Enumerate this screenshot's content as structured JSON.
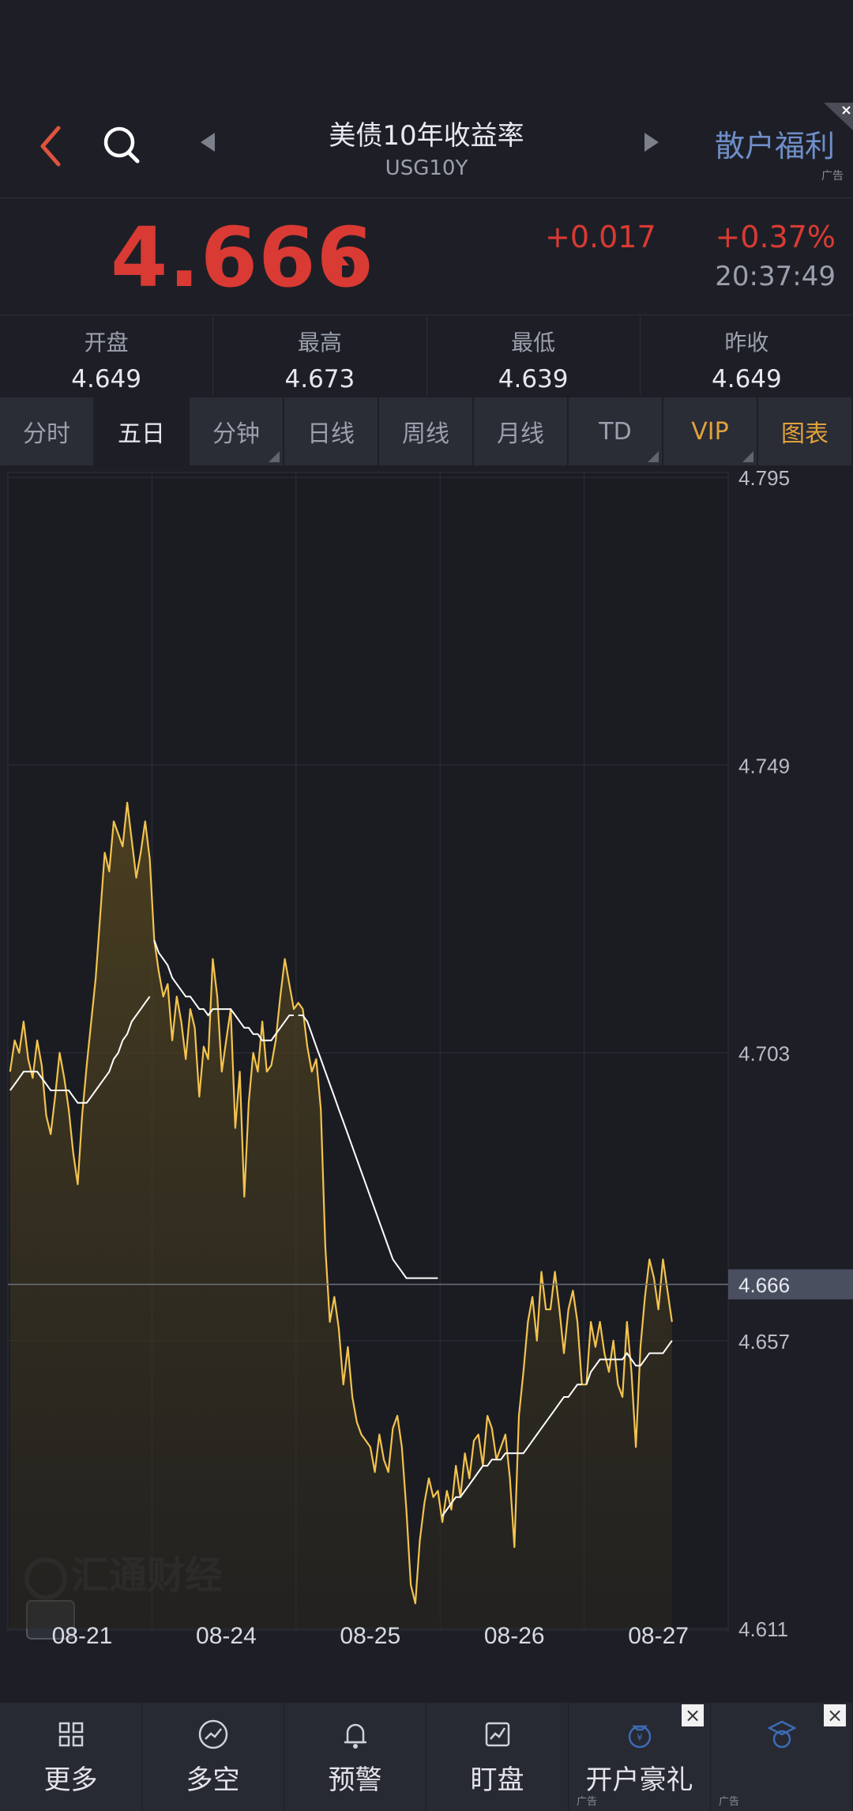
{
  "header": {
    "title": "美债10年收益率",
    "symbol": "USG10Y",
    "promo": "散户福利",
    "ad_label": "广告"
  },
  "quote": {
    "price": "4.666",
    "change": "+0.017",
    "change_pct": "+0.37%",
    "time": "20:37:49",
    "color": "#d93a33"
  },
  "stats": [
    {
      "label": "开盘",
      "value": "4.649"
    },
    {
      "label": "最高",
      "value": "4.673"
    },
    {
      "label": "最低",
      "value": "4.639"
    },
    {
      "label": "昨收",
      "value": "4.649"
    }
  ],
  "tabs": [
    {
      "label": "分时",
      "active": false,
      "dropdown": false,
      "gold": false
    },
    {
      "label": "五日",
      "active": true,
      "dropdown": false,
      "gold": false
    },
    {
      "label": "分钟",
      "active": false,
      "dropdown": true,
      "gold": false
    },
    {
      "label": "日线",
      "active": false,
      "dropdown": false,
      "gold": false
    },
    {
      "label": "周线",
      "active": false,
      "dropdown": false,
      "gold": false
    },
    {
      "label": "月线",
      "active": false,
      "dropdown": false,
      "gold": false
    },
    {
      "label": "TD",
      "active": false,
      "dropdown": true,
      "gold": false
    },
    {
      "label": "VIP",
      "active": false,
      "dropdown": true,
      "gold": true
    },
    {
      "label": "图表",
      "active": false,
      "dropdown": false,
      "gold": true
    }
  ],
  "chart_data": {
    "type": "line",
    "y_ticks": [
      "4.795",
      "4.749",
      "4.703",
      "4.657",
      "4.611"
    ],
    "ylim": [
      4.611,
      4.795
    ],
    "current_label": "4.666",
    "current_value": 4.666,
    "x_labels": [
      "08-21",
      "08-24",
      "08-25",
      "08-26",
      "08-27"
    ],
    "watermark": "汇通财经",
    "line_color": "#f3c34e",
    "avg_color": "#ffffff",
    "series": [
      {
        "days": [
          {
            "prices": [
              4.7,
              4.705,
              4.703,
              4.708,
              4.702,
              4.699,
              4.705,
              4.701,
              4.693,
              4.69,
              4.696,
              4.703,
              4.699,
              4.694,
              4.687,
              4.682,
              4.693,
              4.701,
              4.708,
              4.715,
              4.725,
              4.735,
              4.732,
              4.74,
              4.738,
              4.736,
              4.743,
              4.737,
              4.731,
              4.735,
              4.74,
              4.734
            ],
            "avg": [
              4.697,
              4.698,
              4.699,
              4.7,
              4.7,
              4.7,
              4.7,
              4.699,
              4.698,
              4.697,
              4.697,
              4.697,
              4.697,
              4.697,
              4.696,
              4.695,
              4.695,
              4.695,
              4.696,
              4.697,
              4.698,
              4.699,
              4.7,
              4.702,
              4.703,
              4.705,
              4.706,
              4.708,
              4.709,
              4.71,
              4.711,
              4.712
            ]
          },
          {
            "prices": [
              4.721,
              4.716,
              4.712,
              4.714,
              4.705,
              4.712,
              4.708,
              4.702,
              4.71,
              4.707,
              4.696,
              4.704,
              4.702,
              4.718,
              4.712,
              4.7,
              4.705,
              4.71,
              4.691,
              4.7,
              4.68,
              4.695,
              4.703,
              4.7,
              4.708,
              4.7,
              4.701,
              4.705,
              4.712,
              4.718,
              4.714,
              4.71
            ],
            "avg": [
              4.721,
              4.719,
              4.718,
              4.717,
              4.715,
              4.714,
              4.713,
              4.712,
              4.712,
              4.711,
              4.71,
              4.71,
              4.709,
              4.71,
              4.71,
              4.71,
              4.71,
              4.71,
              4.709,
              4.708,
              4.707,
              4.707,
              4.706,
              4.706,
              4.705,
              4.705,
              4.705,
              4.706,
              4.707,
              4.708,
              4.709,
              4.709
            ]
          },
          {
            "prices": [
              4.711,
              4.71,
              4.704,
              4.7,
              4.702,
              4.694,
              4.672,
              4.66,
              4.664,
              4.659,
              4.65,
              4.656,
              4.648,
              4.644,
              4.642,
              4.641,
              4.64,
              4.636,
              4.642,
              4.638,
              4.636,
              4.643,
              4.645,
              4.64,
              4.63,
              4.618,
              4.615,
              4.625,
              4.631,
              4.635,
              4.632,
              4.633
            ],
            "avg": [
              4.709,
              4.709,
              4.708,
              4.706,
              4.704,
              4.702,
              4.7,
              4.698,
              4.696,
              4.694,
              4.692,
              4.69,
              4.688,
              4.686,
              4.684,
              4.682,
              4.68,
              4.678,
              4.676,
              4.674,
              4.672,
              4.67,
              4.669,
              4.668,
              4.667,
              4.667,
              4.667,
              4.667,
              4.667,
              4.667,
              4.667,
              4.667
            ]
          },
          {
            "prices": [
              4.628,
              4.633,
              4.63,
              4.637,
              4.632,
              4.639,
              4.635,
              4.641,
              4.642,
              4.637,
              4.645,
              4.643,
              4.638,
              4.64,
              4.642,
              4.635,
              4.624,
              4.645,
              4.652,
              4.66,
              4.664,
              4.657,
              4.668,
              4.662,
              4.662,
              4.668,
              4.662,
              4.655,
              4.662,
              4.665,
              4.66,
              4.65
            ],
            "avg": [
              4.629,
              4.63,
              4.631,
              4.632,
              4.632,
              4.633,
              4.634,
              4.635,
              4.636,
              4.637,
              4.637,
              4.638,
              4.638,
              4.638,
              4.639,
              4.639,
              4.639,
              4.639,
              4.639,
              4.64,
              4.641,
              4.642,
              4.643,
              4.644,
              4.645,
              4.646,
              4.647,
              4.648,
              4.648,
              4.649,
              4.65,
              4.65
            ]
          },
          {
            "prices": [
              4.65,
              4.66,
              4.656,
              4.66,
              4.655,
              4.652,
              4.657,
              4.65,
              4.648,
              4.66,
              4.652,
              4.64,
              4.656,
              4.664,
              4.67,
              4.667,
              4.662,
              4.67,
              4.665,
              4.66
            ],
            "avg": [
              4.65,
              4.652,
              4.653,
              4.654,
              4.654,
              4.654,
              4.654,
              4.654,
              4.654,
              4.655,
              4.654,
              4.653,
              4.653,
              4.654,
              4.655,
              4.655,
              4.655,
              4.655,
              4.656,
              4.657
            ]
          }
        ]
      }
    ]
  },
  "nav": [
    {
      "label": "更多",
      "icon": "grid-icon"
    },
    {
      "label": "多空",
      "icon": "trend-circle-icon"
    },
    {
      "label": "预警",
      "icon": "bell-icon"
    },
    {
      "label": "盯盘",
      "icon": "watch-chart-icon"
    },
    {
      "label": "开户豪礼",
      "icon": "money-bag-icon"
    },
    {
      "label": "",
      "icon": "education-icon"
    }
  ],
  "nav_ad_label": "广告"
}
